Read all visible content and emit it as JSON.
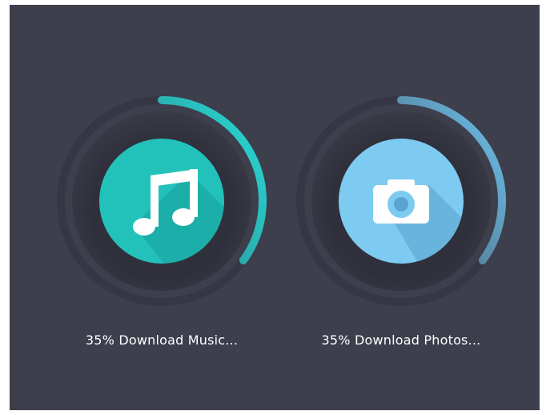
{
  "downloads": [
    {
      "id": "music",
      "progress": 0.35,
      "label": "35% Download Music...",
      "icon": "music-note-icon",
      "colors": {
        "arc_start": "#2ea7a6",
        "arc_end": "#29dcd8",
        "track": "#343541",
        "badge": "#22c2bb",
        "badge_shadow": "#1b9f9a"
      }
    },
    {
      "id": "photos",
      "progress": 0.35,
      "label": "35% Download Photos...",
      "icon": "camera-icon",
      "colors": {
        "arc_start": "#4f6f86",
        "arc_end": "#6ec2ee",
        "track": "#343541",
        "badge": "#7ecbf1",
        "badge_shadow": "#5aa5cf"
      }
    }
  ],
  "background": "#3e3f4c"
}
